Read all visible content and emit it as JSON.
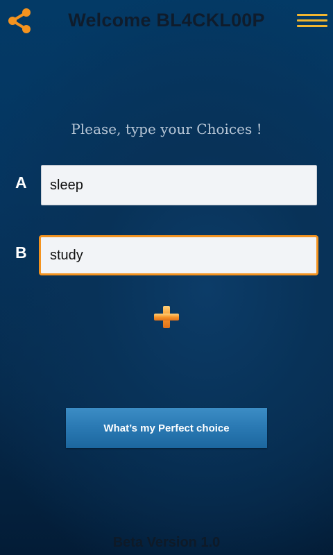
{
  "header": {
    "title": "Welcome BL4CKL00P",
    "share_icon": "share-icon",
    "menu_icon": "hamburger-menu-icon"
  },
  "prompt": "Please, type your Choices !",
  "choices": [
    {
      "label": "A",
      "value": "sleep",
      "focused": false
    },
    {
      "label": "B",
      "value": "study",
      "focused": true
    }
  ],
  "add_icon": "plus-icon",
  "primary_button": {
    "label": "What’s my Perfect choice"
  },
  "footer": {
    "version": "Beta Version 1.0"
  },
  "colors": {
    "accent": "#f4931f",
    "menu_accent": "#f2b630",
    "button": "#2b7ab4",
    "background": "#053560"
  }
}
